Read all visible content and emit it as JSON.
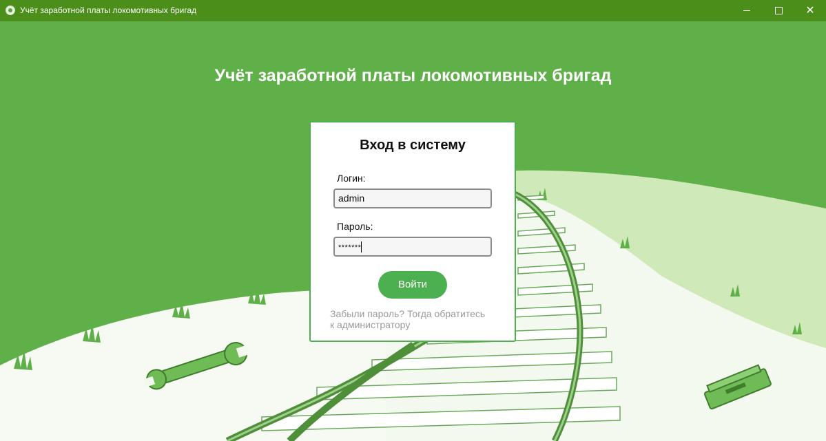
{
  "window": {
    "title": "Учёт заработной платы локомотивных бригад",
    "controls": {
      "minimize": "minimize-icon",
      "maximize": "maximize-icon",
      "close": "close-icon"
    }
  },
  "header": {
    "title": "Учёт заработной платы локомотивных бригад"
  },
  "login_form": {
    "title": "Вход в систему",
    "login_label": "Логин:",
    "login_value": "admin",
    "password_label": "Пароль:",
    "password_value": "*******",
    "submit_label": "Войти",
    "forgot_text": "Забыли пароль? Тогда обратитесь к администратору"
  },
  "colors": {
    "titlebar": "#4b8f1a",
    "background": "#5eae47",
    "accent": "#4caf50"
  }
}
